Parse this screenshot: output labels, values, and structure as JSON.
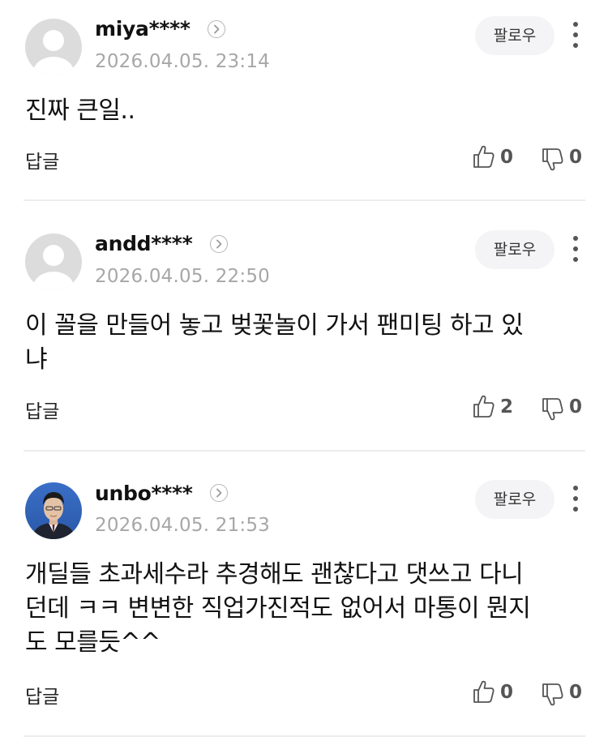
{
  "comments": [
    {
      "username": "miya****",
      "date": "2026.04.05. 23:14",
      "follow_label": "팔로우",
      "text": "진짜 큰일..",
      "reply_label": "답글",
      "likes": "0",
      "dislikes": "0",
      "avatar": "default-avatar"
    },
    {
      "username": "andd****",
      "date": "2026.04.05. 22:50",
      "follow_label": "팔로우",
      "text": "이 꼴을 만들어 놓고 벚꽃놀이 가서 팬미팅 하고 있\n냐",
      "reply_label": "답글",
      "likes": "2",
      "dislikes": "0",
      "avatar": "default-avatar"
    },
    {
      "username": "unbo****",
      "date": "2026.04.05. 21:53",
      "follow_label": "팔로우",
      "text": "개딜들 초과세수라 추경해도 괜찮다고 댓쓰고 다니\n던데 ㅋㅋ 변변한 직업가진적도 없어서 마통이 뭔지\n도 모를듯^^",
      "reply_label": "답글",
      "likes": "0",
      "dislikes": "0",
      "avatar": "profile-photo"
    }
  ],
  "icons": {
    "like": "thumbs-up-icon",
    "dislike": "thumbs-down-icon",
    "more": "more-vertical-icon",
    "profile_link": "chevron-right-icon"
  },
  "colors": {
    "text": "#111111",
    "date": "#a7a7a7",
    "follow_bg": "#f4f4f6",
    "divider": "#ededed",
    "count": "#555555"
  }
}
